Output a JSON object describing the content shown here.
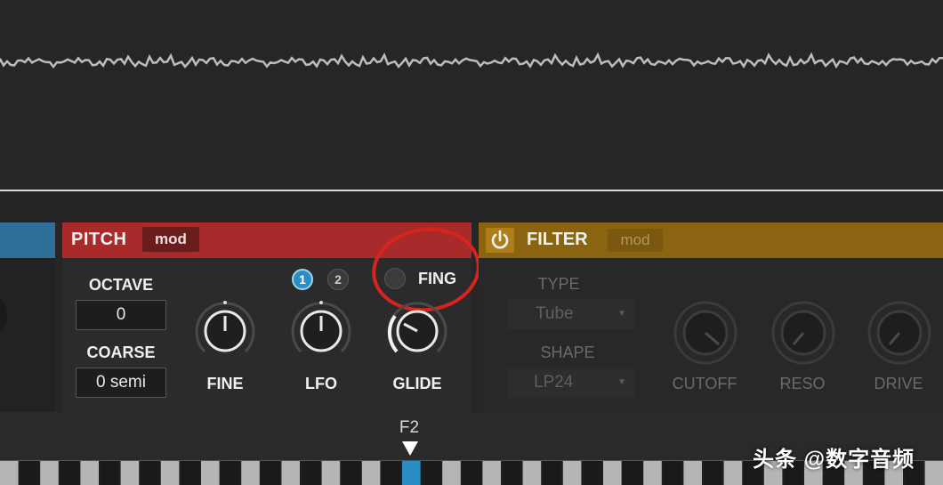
{
  "pitch": {
    "title": "PITCH",
    "mod_label": "mod",
    "octave": {
      "label": "OCTAVE",
      "value": "0"
    },
    "coarse": {
      "label": "COARSE",
      "value": "0 semi"
    },
    "fine_label": "FINE",
    "lfo_label": "LFO",
    "glide_label": "GLIDE",
    "lfo_buttons": [
      "1",
      "2"
    ],
    "fing_label": "FING"
  },
  "filter": {
    "title": "FILTER",
    "mod_label": "mod",
    "type": {
      "label": "TYPE",
      "value": "Tube"
    },
    "shape": {
      "label": "SHAPE",
      "value": "LP24"
    },
    "cutoff_label": "CUTOFF",
    "reso_label": "RESO",
    "drive_label": "DRIVE"
  },
  "keyboard": {
    "note_label": "F2"
  },
  "watermark": "头条 @数字音频",
  "colors": {
    "pitch_header": "#a82a2a",
    "filter_header": "#8a6410",
    "lfo_active": "#2a8dc4",
    "highlight_circle": "#d8231f",
    "active_key": "#2a8dc4"
  },
  "icons": {
    "filter_power": "power-icon",
    "note_marker": "triangle-down-icon"
  }
}
